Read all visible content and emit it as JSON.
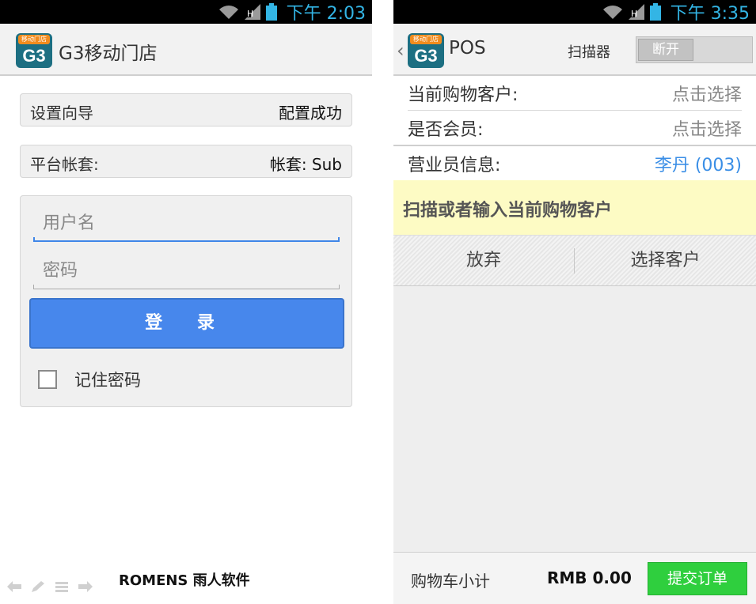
{
  "left_screen": {
    "status_bar": {
      "time": "下午 2:03"
    },
    "header": {
      "logo_caption": "移动门店",
      "logo_text": "G3",
      "title": "G3移动门店"
    },
    "setup_wizard": {
      "label": "设置向导",
      "value": "配置成功"
    },
    "platform_account": {
      "label": "平台帐套:",
      "value": "帐套: Sub"
    },
    "login_form": {
      "username_placeholder": "用户名",
      "password_placeholder": "密码",
      "login_button": "登 录",
      "remember_password": "记住密码"
    },
    "footer_brand": "ROMENS 雨人软件"
  },
  "right_screen": {
    "status_bar": {
      "time": "下午 3:35"
    },
    "header": {
      "logo_caption": "移动门店",
      "logo_text": "G3",
      "title": "POS",
      "scanner_label": "扫描器",
      "scanner_toggle": "断开"
    },
    "info_rows": [
      {
        "label": "当前购物客户:",
        "value": "点击选择"
      },
      {
        "label": "是否会员:",
        "value": "点击选择"
      },
      {
        "label": "营业员信息:",
        "value": "李丹 (003)"
      }
    ],
    "prompt": "扫描或者输入当前购物客户",
    "actions": {
      "abandon": "放弃",
      "select_customer": "选择客户"
    },
    "bottom": {
      "subtotal_label": "购物车小计",
      "subtotal_value": "RMB 0.00",
      "submit_button": "提交订单"
    }
  },
  "colors": {
    "accent_blue": "#4787ec",
    "status_time": "#33b5e5",
    "submit_green": "#2fcf3e",
    "prompt_bg": "#fdfbc4",
    "link_blue": "#3a8ee6"
  }
}
